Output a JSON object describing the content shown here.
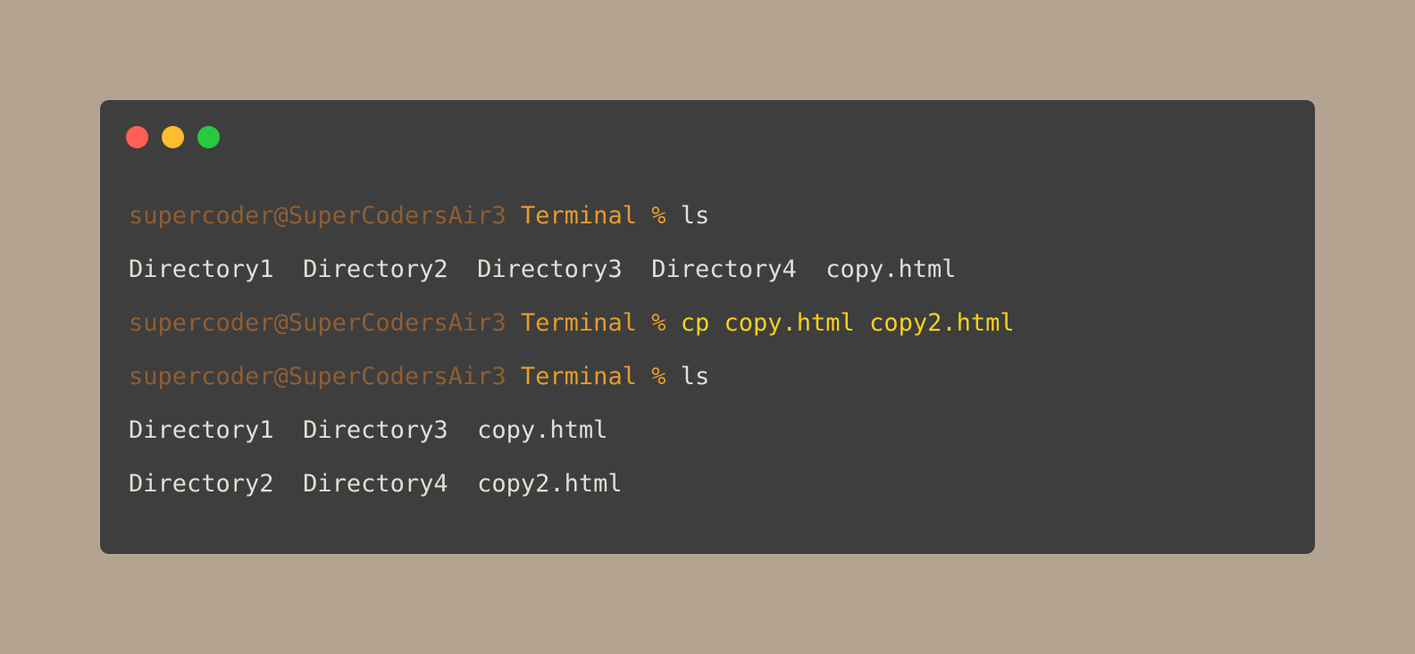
{
  "window": {
    "colors": {
      "background": "#b5a391",
      "terminal_bg": "#3e3e3e",
      "close": "#fe5f57",
      "minimize": "#febc2e",
      "zoom": "#28c840",
      "host": "#8f5e33",
      "dir": "#e69b2b",
      "command_highlight": "#f4d21b",
      "text": "#e1dfd5"
    },
    "buttons": {
      "close": "close-button",
      "minimize": "minimize-button",
      "zoom": "zoom-button"
    }
  },
  "terminal": {
    "line1": {
      "host": "supercoder@SuperCodersAir3",
      "dir": "Terminal",
      "prompt": "%",
      "command": "ls"
    },
    "line2": {
      "text": "Directory1  Directory2  Directory3  Directory4  copy.html"
    },
    "line3": {
      "host": "supercoder@SuperCodersAir3",
      "dir": "Terminal",
      "prompt": "%",
      "command": "cp copy.html copy2.html"
    },
    "line4": {
      "host": "supercoder@SuperCodersAir3",
      "dir": "Terminal",
      "prompt": "%",
      "command": "ls"
    },
    "line5": {
      "text": "Directory1  Directory3  copy.html"
    },
    "line6": {
      "text": "Directory2  Directory4  copy2.html"
    }
  }
}
